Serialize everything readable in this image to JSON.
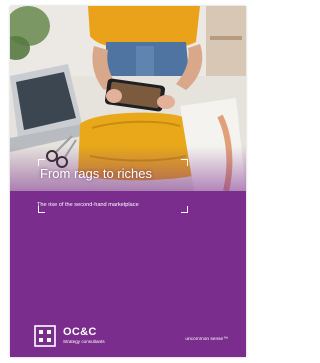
{
  "cover": {
    "title": "From rags to riches",
    "subtitle": "The rise of the second-hand marketplace",
    "brand_name": "OC&C",
    "brand_sub": "Strategy consultants",
    "tagline": "uncommon sense™",
    "colors": {
      "background_purple": "#7a2d8c",
      "text": "#ffffff",
      "sweater_yellow": "#e8a81a"
    },
    "photo_description_icons": [
      "laptop",
      "phone",
      "folded-yellow-sweater",
      "scissors",
      "hands"
    ]
  }
}
